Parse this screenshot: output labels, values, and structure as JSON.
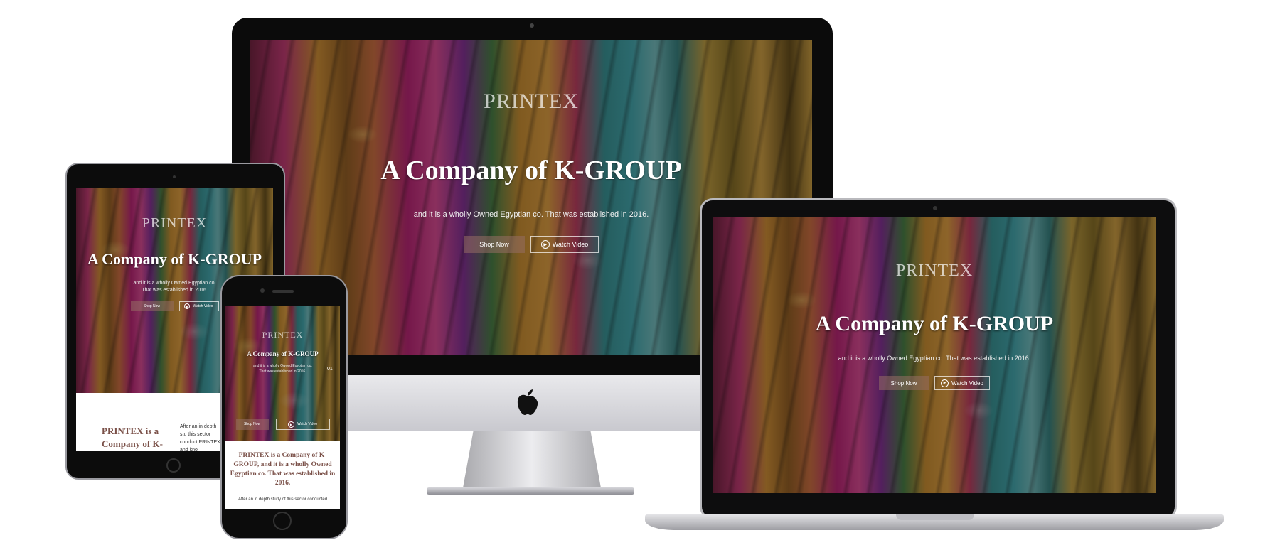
{
  "site": {
    "logo": "PRINTEX",
    "headline": "A Company of K-GROUP",
    "tagline": "and it is a wholly Owned Egyptian co. That was established in 2016.",
    "shop_now": "Shop Now",
    "watch_video": "Watch Video"
  },
  "tablet": {
    "headline": "A Company of K-GROUP",
    "body_heading": "PRINTEX is a Company of K-",
    "body_side_text": "After an in depth stu this sector conduct PRINTEX, and kno",
    "tagline": "and it is a wholly Owned Egyptian co. That was established in 2016."
  },
  "phone": {
    "headline": "A Company of K-GROUP",
    "tagline": "and it is a wholly Owned Egyptian co. That was established in 2016.",
    "slide_number": "01",
    "body_heading": "PRINTEX is a Company of K-GROUP, and it is a wholly Owned Egyptian co. That was established in 2016.",
    "body_text": "After an in depth study of this sector conducted"
  },
  "icons": {
    "apple": "apple-logo-icon",
    "play": "play-circle-icon"
  }
}
